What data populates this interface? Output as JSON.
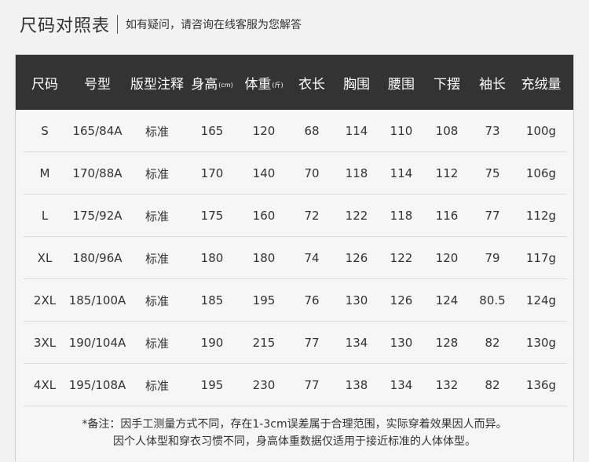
{
  "title": "尺码对照表",
  "subtitle": "如有疑问，请咨询在线客服为您解答",
  "headers": [
    {
      "label": "尺码",
      "unit": ""
    },
    {
      "label": "号型",
      "unit": ""
    },
    {
      "label": "版型注释",
      "unit": ""
    },
    {
      "label": "身高",
      "unit": "(cm)"
    },
    {
      "label": "体重",
      "unit": "(斤)"
    },
    {
      "label": "衣长",
      "unit": ""
    },
    {
      "label": "胸围",
      "unit": ""
    },
    {
      "label": "腰围",
      "unit": ""
    },
    {
      "label": "下摆",
      "unit": ""
    },
    {
      "label": "袖长",
      "unit": ""
    },
    {
      "label": "充绒量",
      "unit": ""
    }
  ],
  "rows": [
    [
      "S",
      "165/84A",
      "标准",
      "165",
      "120",
      "68",
      "114",
      "110",
      "108",
      "73",
      "100g"
    ],
    [
      "M",
      "170/88A",
      "标准",
      "170",
      "140",
      "70",
      "118",
      "114",
      "112",
      "75",
      "106g"
    ],
    [
      "L",
      "175/92A",
      "标准",
      "175",
      "160",
      "72",
      "122",
      "118",
      "116",
      "77",
      "112g"
    ],
    [
      "XL",
      "180/96A",
      "标准",
      "180",
      "180",
      "74",
      "126",
      "122",
      "120",
      "79",
      "117g"
    ],
    [
      "2XL",
      "185/100A",
      "标准",
      "185",
      "195",
      "76",
      "130",
      "126",
      "124",
      "80.5",
      "124g"
    ],
    [
      "3XL",
      "190/104A",
      "标准",
      "190",
      "215",
      "77",
      "134",
      "130",
      "128",
      "82",
      "130g"
    ],
    [
      "4XL",
      "195/108A",
      "标准",
      "195",
      "230",
      "77",
      "138",
      "134",
      "132",
      "82",
      "136g"
    ]
  ],
  "notes": [
    "*备注：因手工测量方式不同，存在1-3cm误差属于合理范围，实际穿着效果因人而异。",
    "因个人体型和穿衣习惯不同，身高体重数据仅适用于接近标准的人体体型。"
  ]
}
